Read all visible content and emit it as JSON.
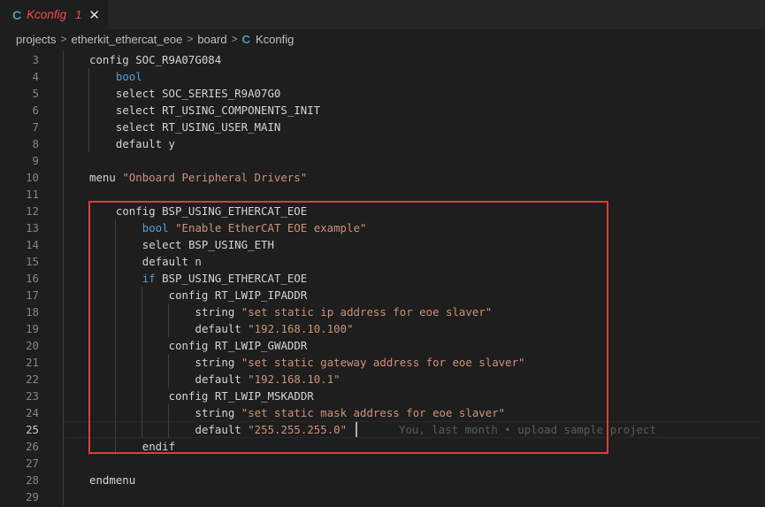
{
  "tab": {
    "icon": "C",
    "filename": "Kconfig",
    "problem_count": "1",
    "close": "✕"
  },
  "breadcrumb": [
    "projects",
    "etherkit_ethercat_eoe",
    "board",
    "Kconfig"
  ],
  "breadcrumb_file_icon": "C",
  "editor": {
    "active_line": "25",
    "lines": [
      {
        "num": "3",
        "indent": 4,
        "tokens": [
          [
            "t",
            "config SOC_R9A07G084"
          ]
        ]
      },
      {
        "num": "4",
        "indent": 8,
        "tokens": [
          [
            "k",
            "bool"
          ]
        ]
      },
      {
        "num": "5",
        "indent": 8,
        "tokens": [
          [
            "t",
            "select SOC_SERIES_R9A07G0"
          ]
        ]
      },
      {
        "num": "6",
        "indent": 8,
        "tokens": [
          [
            "t",
            "select RT_USING_COMPONENTS_INIT"
          ]
        ]
      },
      {
        "num": "7",
        "indent": 8,
        "tokens": [
          [
            "t",
            "select RT_USING_USER_MAIN"
          ]
        ]
      },
      {
        "num": "8",
        "indent": 8,
        "tokens": [
          [
            "t",
            "default y"
          ]
        ]
      },
      {
        "num": "9",
        "indent": 0,
        "tokens": []
      },
      {
        "num": "10",
        "indent": 4,
        "tokens": [
          [
            "t",
            "menu "
          ],
          [
            "s",
            "\"Onboard Peripheral Drivers\""
          ]
        ]
      },
      {
        "num": "11",
        "indent": 0,
        "tokens": []
      },
      {
        "num": "12",
        "indent": 8,
        "tokens": [
          [
            "t",
            "config BSP_USING_ETHERCAT_EOE"
          ]
        ]
      },
      {
        "num": "13",
        "indent": 12,
        "tokens": [
          [
            "k",
            "bool "
          ],
          [
            "s",
            "\"Enable EtherCAT EOE example\""
          ]
        ]
      },
      {
        "num": "14",
        "indent": 12,
        "tokens": [
          [
            "t",
            "select BSP_USING_ETH"
          ]
        ]
      },
      {
        "num": "15",
        "indent": 12,
        "tokens": [
          [
            "t",
            "default n"
          ]
        ]
      },
      {
        "num": "16",
        "indent": 12,
        "tokens": [
          [
            "k",
            "if"
          ],
          [
            "t",
            " BSP_USING_ETHERCAT_EOE"
          ]
        ]
      },
      {
        "num": "17",
        "indent": 16,
        "tokens": [
          [
            "t",
            "config RT_LWIP_IPADDR"
          ]
        ]
      },
      {
        "num": "18",
        "indent": 20,
        "tokens": [
          [
            "t",
            "string "
          ],
          [
            "s",
            "\"set static ip address for eoe slaver\""
          ]
        ]
      },
      {
        "num": "19",
        "indent": 20,
        "tokens": [
          [
            "t",
            "default "
          ],
          [
            "s",
            "\"192.168.10.100\""
          ]
        ]
      },
      {
        "num": "20",
        "indent": 16,
        "tokens": [
          [
            "t",
            "config RT_LWIP_GWADDR"
          ]
        ]
      },
      {
        "num": "21",
        "indent": 20,
        "tokens": [
          [
            "t",
            "string "
          ],
          [
            "s",
            "\"set static gateway address for eoe slaver\""
          ]
        ]
      },
      {
        "num": "22",
        "indent": 20,
        "tokens": [
          [
            "t",
            "default "
          ],
          [
            "s",
            "\"192.168.10.1\""
          ]
        ]
      },
      {
        "num": "23",
        "indent": 16,
        "tokens": [
          [
            "t",
            "config RT_LWIP_MSKADDR"
          ]
        ]
      },
      {
        "num": "24",
        "indent": 20,
        "tokens": [
          [
            "t",
            "string "
          ],
          [
            "s",
            "\"set static mask address for eoe slaver\""
          ]
        ]
      },
      {
        "num": "25",
        "indent": 20,
        "tokens": [
          [
            "t",
            "default "
          ],
          [
            "s",
            "\"255.255.255.0\""
          ]
        ]
      },
      {
        "num": "26",
        "indent": 12,
        "tokens": [
          [
            "t",
            "endif"
          ]
        ]
      },
      {
        "num": "27",
        "indent": 0,
        "tokens": []
      },
      {
        "num": "28",
        "indent": 4,
        "tokens": [
          [
            "t",
            "endmenu"
          ]
        ]
      },
      {
        "num": "29",
        "indent": 0,
        "tokens": []
      }
    ],
    "blame": "You, last month • upload sample project"
  },
  "colors": {
    "keyword": "#569cd6",
    "string": "#ce9178",
    "text": "#d4d4d4",
    "tab_error": "#f14c4c",
    "highlight_box": "#e03a3a"
  }
}
